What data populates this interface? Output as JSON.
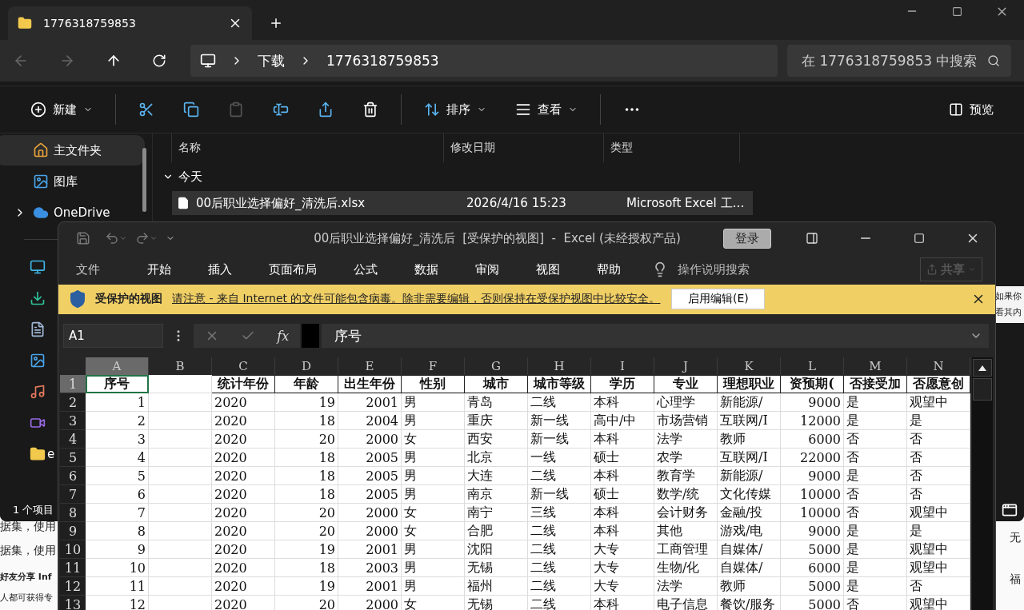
{
  "explorer": {
    "tab": {
      "title": "1776318759853"
    },
    "breadcrumbs": [
      "下载",
      "1776318759853"
    ],
    "search": {
      "placeholder": "在 1776318759853 中搜索"
    },
    "toolbar": {
      "new": "新建",
      "sort": "排序",
      "view": "查看",
      "preview": "预览"
    },
    "sidebar": [
      {
        "kind": "home",
        "label": "主文件夹",
        "selected": true,
        "expandable": false
      },
      {
        "kind": "gallery",
        "label": "图库",
        "selected": false,
        "expandable": false
      },
      {
        "kind": "cloud",
        "label": "OneDrive",
        "selected": false,
        "expandable": true
      },
      {
        "kind": "divider"
      },
      {
        "kind": "desktop",
        "selected": false,
        "expandable": false
      },
      {
        "kind": "download",
        "selected": false,
        "expandable": false
      },
      {
        "kind": "documents",
        "selected": false,
        "expandable": false
      },
      {
        "kind": "pictures",
        "selected": false,
        "expandable": false
      },
      {
        "kind": "music",
        "selected": false,
        "expandable": false
      },
      {
        "kind": "videos",
        "selected": false,
        "expandable": false
      },
      {
        "kind": "folder",
        "label": "e",
        "selected": false,
        "expandable": false
      }
    ],
    "columns": [
      "名称",
      "修改日期",
      "类型"
    ],
    "group": "今天",
    "files": [
      {
        "name": "00后职业选择偏好_清洗后.xlsx",
        "date": "2026/4/16 15:23",
        "type": "Microsoft Excel 工…",
        "selected": true
      }
    ],
    "status": "1 个项目"
  },
  "excel": {
    "title": "00后职业选择偏好_清洗后  [受保护的视图]  -  Excel (未经授权产品)",
    "sign_in": "登录",
    "menu": [
      "文件",
      "开始",
      "插入",
      "页面布局",
      "公式",
      "数据",
      "审阅",
      "视图",
      "帮助"
    ],
    "tell_me": "操作说明搜索",
    "share": {
      "label": "共享",
      "disabled": true
    },
    "protected_bar": {
      "label": "受保护的视图",
      "message": "请注意 - 来自 Internet 的文件可能包含病毒。除非需要编辑，否则保持在受保护视图中比较安全。",
      "button": "启用编辑(E)"
    },
    "name_box": "A1",
    "formula": "序号",
    "function_button": "fx",
    "columns": [
      {
        "letter": "A",
        "selected": true,
        "numeric": true
      },
      {
        "letter": "B",
        "selected": false
      },
      {
        "letter": "C",
        "selected": false
      },
      {
        "letter": "D",
        "selected": false,
        "numeric": true
      },
      {
        "letter": "E",
        "selected": false,
        "numeric": true
      },
      {
        "letter": "F",
        "selected": false
      },
      {
        "letter": "G",
        "selected": false
      },
      {
        "letter": "H",
        "selected": false
      },
      {
        "letter": "I",
        "selected": false
      },
      {
        "letter": "J",
        "selected": false
      },
      {
        "letter": "K",
        "selected": false
      },
      {
        "letter": "L",
        "selected": false,
        "numeric": true
      },
      {
        "letter": "M",
        "selected": false
      },
      {
        "letter": "N",
        "selected": false
      }
    ],
    "rows": [
      {
        "number": "1",
        "selected": true,
        "header": true,
        "cells": [
          "序号",
          null,
          "统计年份",
          "年龄",
          "出生年份",
          "性别",
          "城市",
          "城市等级",
          "学历",
          "专业",
          "理想职业",
          "资预期(",
          "否接受加",
          "否愿意创"
        ]
      },
      {
        "number": "2",
        "selected": false,
        "header": false,
        "cells": [
          "1",
          null,
          "2020",
          "19",
          "2001",
          "男",
          "青岛",
          "二线",
          "本科",
          "心理学",
          "新能源/",
          "9000",
          "是",
          "观望中"
        ]
      },
      {
        "number": "3",
        "selected": false,
        "header": false,
        "cells": [
          "2",
          null,
          "2020",
          "18",
          "2004",
          "男",
          "重庆",
          "新一线",
          "高中/中",
          "市场营销",
          "互联网/I",
          "12000",
          "是",
          "是"
        ]
      },
      {
        "number": "4",
        "selected": false,
        "header": false,
        "cells": [
          "3",
          null,
          "2020",
          "20",
          "2000",
          "女",
          "西安",
          "新一线",
          "本科",
          "法学",
          "教师",
          "6000",
          "否",
          "否"
        ]
      },
      {
        "number": "5",
        "selected": false,
        "header": false,
        "cells": [
          "4",
          null,
          "2020",
          "18",
          "2005",
          "男",
          "北京",
          "一线",
          "硕士",
          "农学",
          "互联网/I",
          "22000",
          "否",
          "否"
        ]
      },
      {
        "number": "6",
        "selected": false,
        "header": false,
        "cells": [
          "5",
          null,
          "2020",
          "18",
          "2005",
          "男",
          "大连",
          "二线",
          "本科",
          "教育学",
          "新能源/",
          "9000",
          "是",
          "否"
        ]
      },
      {
        "number": "7",
        "selected": false,
        "header": false,
        "cells": [
          "6",
          null,
          "2020",
          "18",
          "2005",
          "男",
          "南京",
          "新一线",
          "硕士",
          "数学/统",
          "文化传媒",
          "10000",
          "否",
          "否"
        ]
      },
      {
        "number": "8",
        "selected": false,
        "header": false,
        "cells": [
          "7",
          null,
          "2020",
          "20",
          "2000",
          "女",
          "南宁",
          "三线",
          "本科",
          "会计财务",
          "金融/投",
          "10000",
          "否",
          "观望中"
        ]
      },
      {
        "number": "9",
        "selected": false,
        "header": false,
        "cells": [
          "8",
          null,
          "2020",
          "20",
          "2000",
          "女",
          "合肥",
          "二线",
          "本科",
          "其他",
          "游戏/电",
          "9000",
          "是",
          "是"
        ]
      },
      {
        "number": "10",
        "selected": false,
        "header": false,
        "cells": [
          "9",
          null,
          "2020",
          "19",
          "2001",
          "男",
          "沈阳",
          "二线",
          "大专",
          "工商管理",
          "自媒体/",
          "5000",
          "是",
          "观望中"
        ]
      },
      {
        "number": "11",
        "selected": false,
        "header": false,
        "cells": [
          "10",
          null,
          "2020",
          "18",
          "2003",
          "男",
          "无锡",
          "二线",
          "大专",
          "生物/化",
          "自媒体/",
          "6000",
          "是",
          "观望中"
        ]
      },
      {
        "number": "12",
        "selected": false,
        "header": false,
        "cells": [
          "11",
          null,
          "2020",
          "19",
          "2001",
          "男",
          "福州",
          "二线",
          "大专",
          "法学",
          "教师",
          "5000",
          "是",
          "否"
        ]
      },
      {
        "number": "13",
        "selected": false,
        "header": false,
        "cells": [
          "12",
          null,
          "2020",
          "20",
          "2000",
          "女",
          "无锡",
          "二线",
          "本科",
          "电子信息",
          "餐饮/服务",
          "5000",
          "否",
          "观望中"
        ]
      }
    ]
  },
  "background_page": {
    "left_lines": [
      "据集，使用",
      "据集，使用",
      "好友分享 Inf",
      "人都可获得专"
    ],
    "right_lines": [
      "如果你",
      "看其内"
    ],
    "bottom_right_lines": [
      "无",
      "福"
    ]
  }
}
